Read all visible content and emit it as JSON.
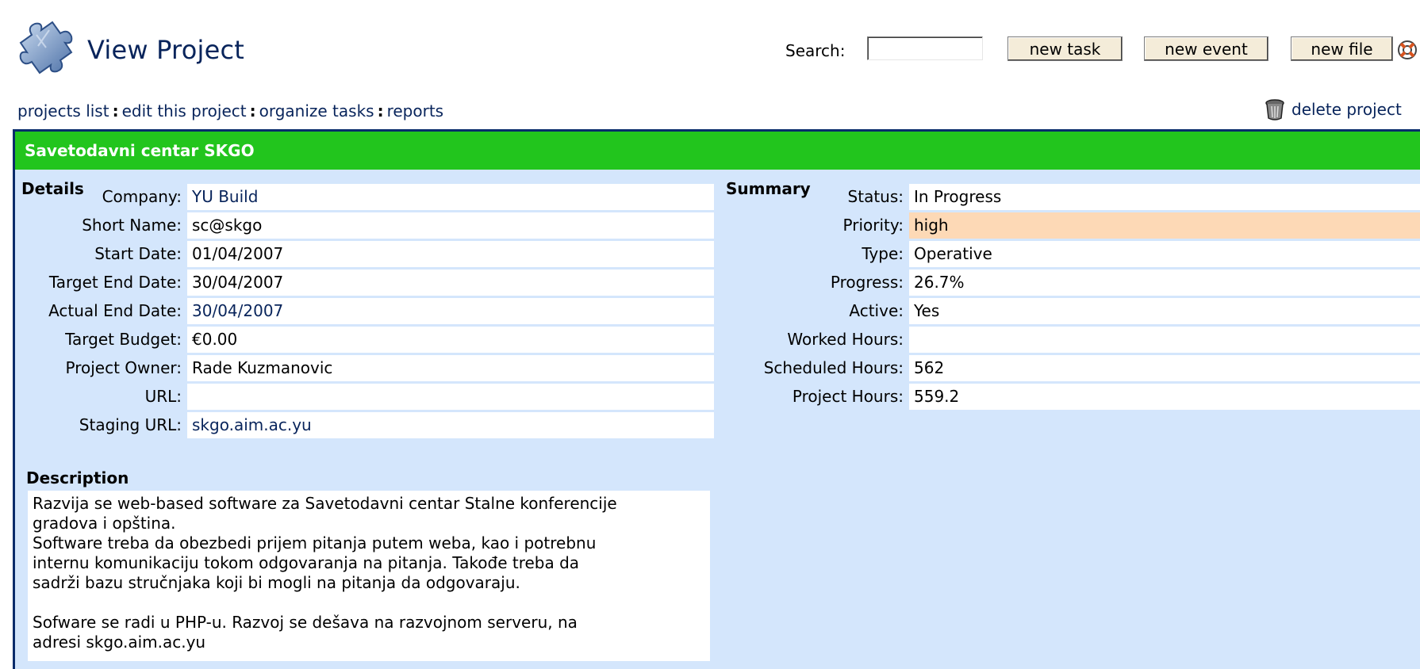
{
  "header": {
    "title": "View Project",
    "search_label": "Search:",
    "search_value": "",
    "buttons": [
      "new task",
      "new event",
      "new file"
    ]
  },
  "nav": {
    "links": [
      "projects list",
      "edit this project",
      "organize tasks",
      "reports"
    ],
    "separator": ":",
    "delete_label": "delete project"
  },
  "project": {
    "name": "Savetodavni centar SKGO"
  },
  "details": {
    "title": "Details",
    "rows": [
      {
        "label": "Company:",
        "value": "YU Build"
      },
      {
        "label": "Short Name:",
        "value": "sc@skgo"
      },
      {
        "label": "Start Date:",
        "value": "01/04/2007"
      },
      {
        "label": "Target End Date:",
        "value": "30/04/2007"
      },
      {
        "label": "Actual End Date:",
        "value": "30/04/2007"
      },
      {
        "label": "Target Budget:",
        "value": "€0.00"
      },
      {
        "label": "Project Owner:",
        "value": "Rade Kuzmanovic"
      },
      {
        "label": "URL:",
        "value": ""
      },
      {
        "label": "Staging URL:",
        "value": "skgo.aim.ac.yu"
      }
    ]
  },
  "summary": {
    "title": "Summary",
    "rows": [
      {
        "label": "Status:",
        "value": "In Progress"
      },
      {
        "label": "Priority:",
        "value": "high"
      },
      {
        "label": "Type:",
        "value": "Operative"
      },
      {
        "label": "Progress:",
        "value": "26.7%"
      },
      {
        "label": "Active:",
        "value": "Yes"
      },
      {
        "label": "Worked Hours:",
        "value": ""
      },
      {
        "label": "Scheduled Hours:",
        "value": "562"
      },
      {
        "label": "Project Hours:",
        "value": "559.2"
      }
    ]
  },
  "description": {
    "title": "Description",
    "text": "Razvija se web-based software za Savetodavni centar Stalne konferencije\ngradova i opština.\nSoftware treba da obezbedi prijem pitanja putem weba, kao i potrebnu\ninternu komunikaciju tokom odgovaranja na pitanja. Takođe treba da\nsadrži bazu stručnjaka koji bi mogli na pitanja da odgovaraju.\n\nSofware se radi u PHP-u. Razvoj se dešava na razvojnom serveru, na\nadresi skgo.aim.ac.yu"
  },
  "colors": {
    "header_bar": "#22c51d",
    "panel_bg": "#d4e6fc",
    "link": "#08245b",
    "priority_high": "#fdd9b6"
  }
}
